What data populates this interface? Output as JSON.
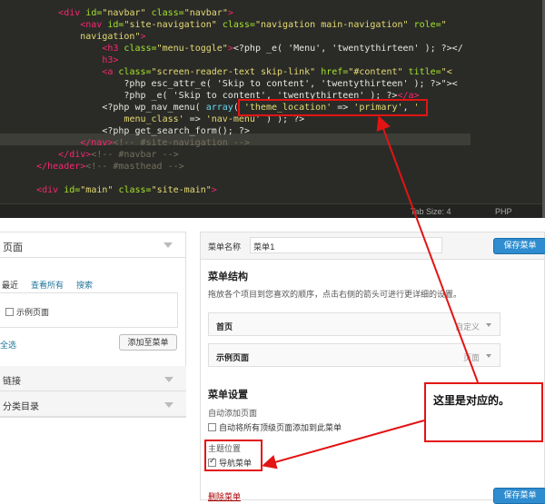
{
  "editor": {
    "lines": [
      {
        "indent": "        ",
        "html": "<span class=\"tag\">&lt;div</span> <span class=\"attr\">id=</span><span class=\"str\">\"navbar\"</span> <span class=\"attr\">class=</span><span class=\"str\">\"navbar\"</span><span class=\"tag\">&gt;</span>"
      },
      {
        "indent": "            ",
        "html": "<span class=\"tag\">&lt;nav</span> <span class=\"attr\">id=</span><span class=\"str\">\"site-navigation\"</span> <span class=\"attr\">class=</span><span class=\"str\">\"navigation main-navigation\"</span> <span class=\"attr\">role=</span><span class=\"str\">\"</span>"
      },
      {
        "indent": "            ",
        "html": "<span class=\"str\">navigation\"</span><span class=\"tag\">&gt;</span>"
      },
      {
        "indent": "                ",
        "html": "<span class=\"tag\">&lt;h3</span> <span class=\"attr\">class=</span><span class=\"str\">\"menu-toggle\"</span><span class=\"tag\">&gt;</span>&lt;?php _e( 'Menu', 'twentythirteen' ); ?&gt;&lt;/"
      },
      {
        "indent": "                ",
        "html": "<span class=\"tag\">h3&gt;</span>"
      },
      {
        "indent": "                ",
        "html": "<span class=\"tag\">&lt;a</span> <span class=\"attr\">class=</span><span class=\"str\">\"screen-reader-text skip-link\"</span> <span class=\"attr\">href=</span><span class=\"str\">\"#content\"</span> <span class=\"attr\">title=</span><span class=\"str\">\"&lt;</span>"
      },
      {
        "indent": "                    ",
        "html": "?php esc_attr_e( 'Skip to content', 'twentythirteen' ); ?&gt;\"&gt;&lt;"
      },
      {
        "indent": "                    ",
        "html": "?php _e( 'Skip to content', 'twentythirteen' ); ?&gt;<span class=\"tag\">&lt;/a&gt;</span>"
      },
      {
        "indent": "                ",
        "html": "&lt;?php wp_nav_menu( <span class=\"kw\">array</span>( <span class=\"str\">'theme_location'</span> =&gt; <span class=\"str\">'primary'</span>, <span class=\"str\">'</span>"
      },
      {
        "indent": "                    ",
        "html": "<span class=\"str\">menu_class'</span> =&gt; <span class=\"str\">'nav-menu'</span> ) ); ?&gt;"
      },
      {
        "indent": "                ",
        "html": "&lt;?php get_search_form(); ?&gt;"
      },
      {
        "indent": "            ",
        "html": "<span class=\"tag\">&lt;/nav&gt;</span><span class=\"cmt\">&lt;!-- #site-navigation --&gt;</span>"
      },
      {
        "indent": "        ",
        "html": "<span class=\"tag\">&lt;/div&gt;</span><span class=\"cmt\">&lt;!-- #navbar --&gt;</span>"
      },
      {
        "indent": "    ",
        "html": "<span class=\"tag\">&lt;/header&gt;</span><span class=\"cmt\">&lt;!-- #masthead --&gt;</span>"
      },
      {
        "indent": "",
        "html": ""
      },
      {
        "indent": "    ",
        "html": "<span class=\"tag\">&lt;div</span> <span class=\"attr\">id=</span><span class=\"str\">\"main\"</span> <span class=\"attr\">class=</span><span class=\"str\">\"site-main\"</span><span class=\"tag\">&gt;</span>"
      }
    ],
    "tab_size": "Tab Size: 4",
    "language": "PHP"
  },
  "left_panel": {
    "header": "页面",
    "tabs": [
      "最近",
      "查看所有",
      "搜索"
    ],
    "list_item": "示例页面",
    "select_all": "全选",
    "add_button": "添加至菜单",
    "accordion": [
      "链接",
      "分类目录"
    ]
  },
  "right_panel": {
    "menu_name_label": "菜单名称",
    "menu_name_value": "菜单1",
    "save_button": "保存菜单",
    "structure_title": "菜单结构",
    "structure_desc": "拖放各个项目到您喜欢的顺序，点击右侧的箭头可进行更详细的设置。",
    "items": [
      {
        "title": "首页",
        "type": "自定义"
      },
      {
        "title": "示例页面",
        "type": "页面"
      }
    ],
    "settings_title": "菜单设置",
    "auto_add_label": "自动添加页面",
    "auto_add_option": "自动将所有顶级页面添加到此菜单",
    "theme_location_label": "主题位置",
    "theme_location_option": "导航菜单",
    "delete_link": "删除菜单",
    "save_button_bottom": "保存菜单"
  },
  "annotation": {
    "text": "这里是对应的。",
    "color": "#e31414"
  }
}
